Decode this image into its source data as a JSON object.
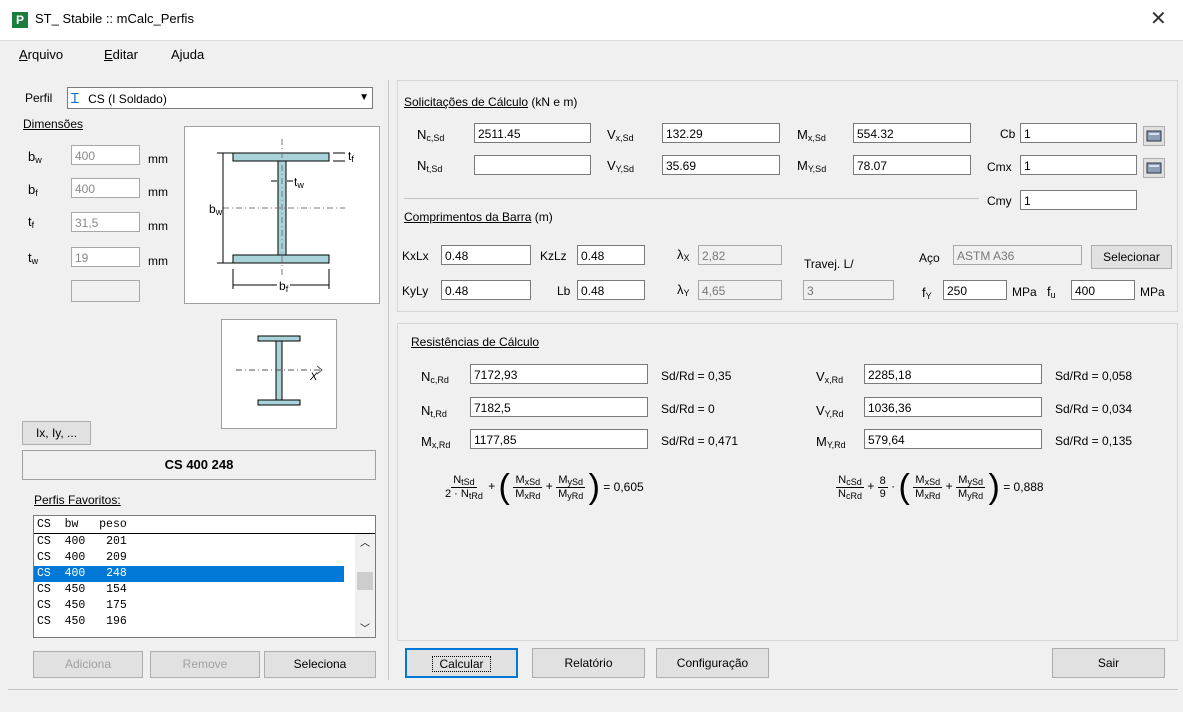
{
  "window": {
    "icon_letter": "P",
    "title": "ST_ Stabile :: mCalc_Perfis",
    "close_glyph": "✕"
  },
  "menu": [
    {
      "accel": "A",
      "rest": "rquivo"
    },
    {
      "accel": "E",
      "rest": "ditar"
    },
    {
      "accel": "",
      "rest": "Ajuda"
    }
  ],
  "perfil": {
    "label": "Perfil",
    "value": "CS (I Soldado)"
  },
  "dimensoes": {
    "title": "Dimensões",
    "rows": [
      {
        "sym": "b",
        "sub": "w",
        "value": "400",
        "unit": "mm"
      },
      {
        "sym": "b",
        "sub": "f",
        "value": "400",
        "unit": "mm"
      },
      {
        "sym": "t",
        "sub": "f",
        "value": "31,5",
        "unit": "mm"
      },
      {
        "sym": "t",
        "sub": "w",
        "value": "19",
        "unit": "mm"
      }
    ],
    "extra_value": ""
  },
  "section_labels": {
    "bw": "b",
    "bw_sub": "w",
    "bf": "b",
    "bf_sub": "f",
    "tf": "t",
    "tf_sub": "f",
    "tw": "t",
    "tw_sub": "w",
    "axis_x": "X"
  },
  "ix_button": "Ix, Iy, ...",
  "profile_name": "CS 400 248",
  "favoritos": {
    "title": "Perfis Favoritos:",
    "columns": [
      "CS",
      "bw",
      "peso"
    ],
    "rows": [
      [
        "CS",
        "400",
        "201"
      ],
      [
        "CS",
        "400",
        "209"
      ],
      [
        "CS",
        "400",
        "248"
      ],
      [
        "CS",
        "450",
        "154"
      ],
      [
        "CS",
        "450",
        "175"
      ],
      [
        "CS",
        "450",
        "196"
      ]
    ],
    "selected_index": 2,
    "buttons": {
      "add": "Adiciona",
      "remove": "Remove",
      "select": "Seleciona"
    }
  },
  "solicitacoes": {
    "title": "Solicitações de Cálculo",
    "units": " (kN e m)",
    "ncsd": {
      "sym": "N",
      "sub": "c,Sd",
      "value": "2511.45"
    },
    "ntsd": {
      "sym": "N",
      "sub": "t,Sd",
      "value": ""
    },
    "vxsd": {
      "sym": "V",
      "sub": "x,Sd",
      "value": "132.29"
    },
    "vysd": {
      "sym": "V",
      "sub": "Y,Sd",
      "value": "35.69"
    },
    "mxsd": {
      "sym": "M",
      "sub": "x,Sd",
      "value": "554.32"
    },
    "mysd": {
      "sym": "M",
      "sub": "Y,Sd",
      "value": "78.07"
    },
    "cb": {
      "label": "Cb",
      "value": "1"
    },
    "cmx": {
      "label": "Cmx",
      "value": "1"
    },
    "cmy": {
      "label": "Cmy",
      "value": "1"
    }
  },
  "comprimentos": {
    "title": "Comprimentos da Barra",
    "units": " (m)",
    "kxlx": {
      "label": "KxLx",
      "value": "0.48"
    },
    "kyly": {
      "label": "KyLy",
      "value": "0.48"
    },
    "kzlz": {
      "label": "KzLz",
      "value": "0.48"
    },
    "lb": {
      "label": "Lb",
      "value": "0.48"
    },
    "lambda_x": {
      "sym": "λ",
      "sub": "X",
      "value": "2,82"
    },
    "lambda_y": {
      "sym": "λ",
      "sub": "Y",
      "value": "4,65"
    },
    "travej": {
      "label": "Travej. L/",
      "value": "3"
    },
    "aco": {
      "label": "Aço",
      "value": "ASTM A36",
      "button": "Selecionar"
    },
    "fy": {
      "sym": "f",
      "sub": "Y",
      "value": "250",
      "unit": "MPa"
    },
    "fu": {
      "sym": "f",
      "sub": "u",
      "value": "400",
      "unit": "MPa"
    }
  },
  "resistencias": {
    "title": "Resistências de Cálculo",
    "ncrd": {
      "sym": "N",
      "sub": "c,Rd",
      "value": "7172,93",
      "ratio": "Sd/Rd = 0,35"
    },
    "ntrd": {
      "sym": "N",
      "sub": "t,Rd",
      "value": "7182,5",
      "ratio": "Sd/Rd = 0"
    },
    "mxrd": {
      "sym": "M",
      "sub": "x,Rd",
      "value": "1177,85",
      "ratio": "Sd/Rd = 0,471"
    },
    "vxrd": {
      "sym": "V",
      "sub": "x,Rd",
      "value": "2285,18",
      "ratio": "Sd/Rd = 0,058"
    },
    "vyrd": {
      "sym": "V",
      "sub": "Y,Rd",
      "value": "1036,36",
      "ratio": "Sd/Rd = 0,034"
    },
    "myrd": {
      "sym": "M",
      "sub": "Y,Rd",
      "value": "579,64",
      "ratio": "Sd/Rd = 0,135"
    },
    "eq1": {
      "f1_num": "N",
      "f1_num_sub": "tSd",
      "f1_den_pre": "2 · N",
      "f1_den_sub": "tRd",
      "f2_num": "M",
      "f2_num_sub": "xSd",
      "f2_den": "M",
      "f2_den_sub": "xRd",
      "f3_num": "M",
      "f3_num_sub": "ySd",
      "f3_den": "M",
      "f3_den_sub": "yRd",
      "result": "= 0,605"
    },
    "eq2": {
      "f1_num": "N",
      "f1_num_sub": "cSd",
      "f1_den": "N",
      "f1_den_sub": "cRd",
      "k_num": "8",
      "k_den": "9",
      "f2_num": "M",
      "f2_num_sub": "xSd",
      "f2_den": "M",
      "f2_den_sub": "xRd",
      "f3_num": "M",
      "f3_num_sub": "ySd",
      "f3_den": "M",
      "f3_den_sub": "yRd",
      "result": "= 0,888"
    }
  },
  "bottom_buttons": {
    "calcular": "Calcular",
    "relatorio": "Relatório",
    "configuracao": "Configuração",
    "sair": "Sair"
  }
}
